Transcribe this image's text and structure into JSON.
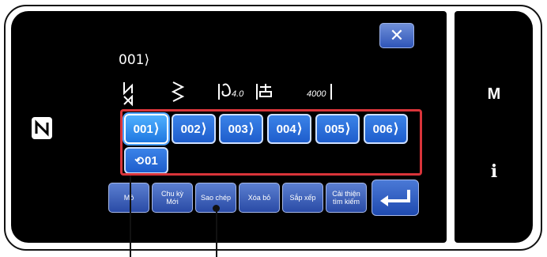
{
  "header": {
    "pattern_no": "001",
    "close_icon": "close-icon"
  },
  "sewing_info": {
    "stitch_width": "4.0",
    "speed": "4000"
  },
  "patterns": [
    {
      "no": "001",
      "active": true
    },
    {
      "no": "002",
      "active": false
    },
    {
      "no": "003",
      "active": false
    },
    {
      "no": "004",
      "active": false
    },
    {
      "no": "005",
      "active": false
    },
    {
      "no": "006",
      "active": false
    }
  ],
  "cycle_button": {
    "label": "01"
  },
  "menu": {
    "mode": "Mô",
    "new_cycle": "Chu kỳ Mới",
    "copy": "Sao chép",
    "delete": "Xóa bỏ",
    "sort": "Sắp xếp",
    "improve_search": "Cải thiện tìm kiếm"
  },
  "side_panel": {
    "m_label": "M",
    "info_label": "i"
  },
  "colors": {
    "button_blue": "#1e5dcc",
    "highlight_red": "#d9343a"
  }
}
